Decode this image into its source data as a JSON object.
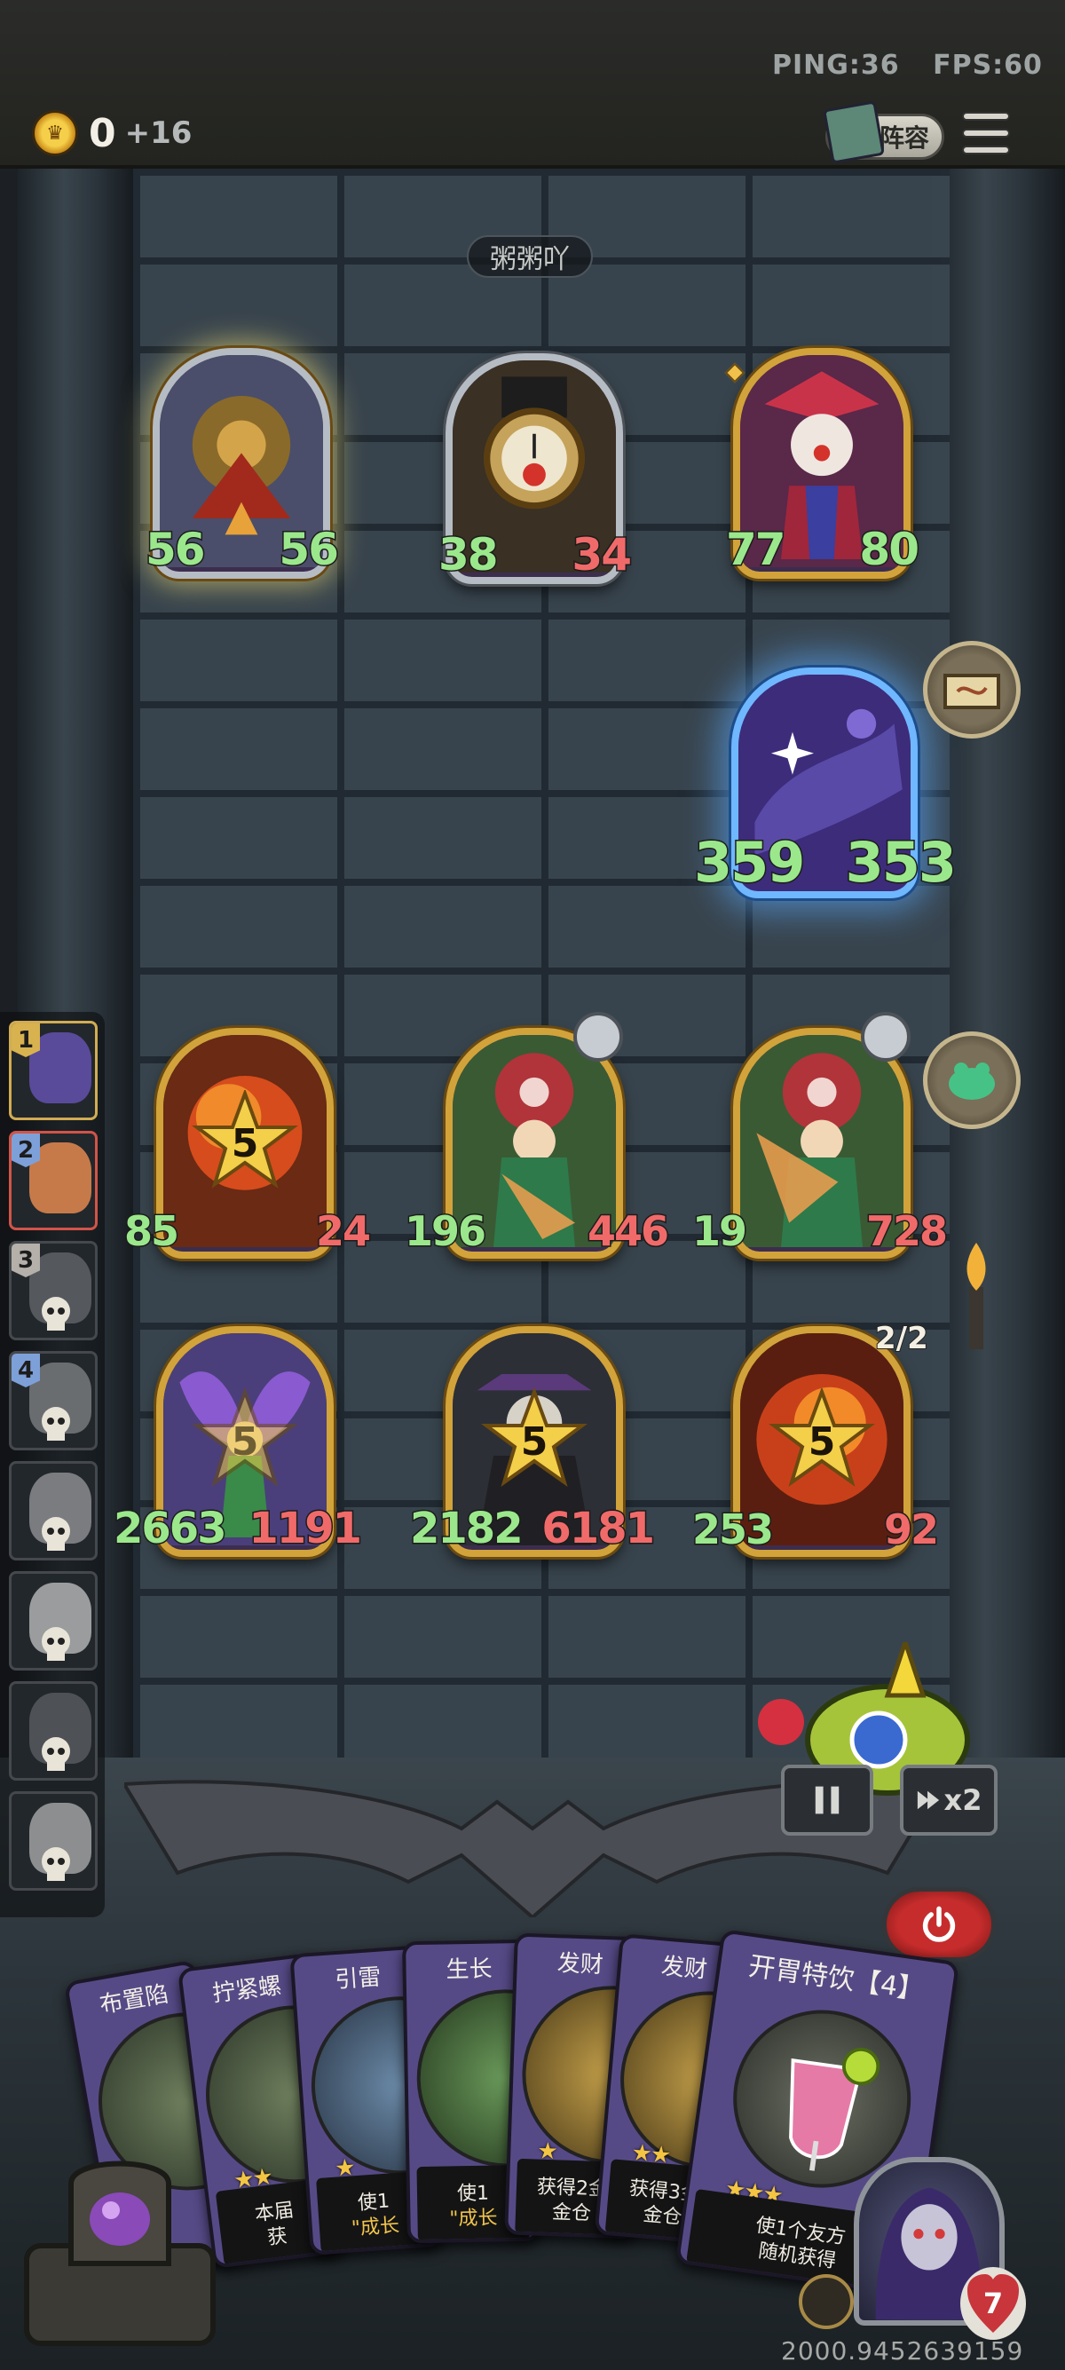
{
  "hud": {
    "ping": "PING:36",
    "fps": "FPS:60",
    "gold": "0",
    "gold_income": "+16",
    "lineup_label": "阵容"
  },
  "opponent": {
    "name": "粥粥吖"
  },
  "enemy_board": [
    {
      "attack": "56",
      "health": "56",
      "frame": "silver"
    },
    {
      "attack": "38",
      "health": "34",
      "frame": "silver"
    },
    {
      "attack": "77",
      "health": "80",
      "frame": "gold"
    }
  ],
  "enemy_boss": {
    "attack": "359",
    "health": "353"
  },
  "player_board": {
    "row1": [
      {
        "attack": "85",
        "health": "24",
        "star": "5"
      },
      {
        "attack": "196",
        "health": "446",
        "star": ""
      },
      {
        "attack": "19",
        "health": "728",
        "star": ""
      }
    ],
    "row2": [
      {
        "attack": "2663",
        "health": "1191",
        "star": "5"
      },
      {
        "attack": "2182",
        "health": "6181",
        "star": "5"
      },
      {
        "attack": "253",
        "health": "92",
        "star": "5",
        "counter": "2/2"
      }
    ]
  },
  "roster": [
    {
      "rank": "1"
    },
    {
      "rank": "2"
    },
    {
      "rank": "3"
    },
    {
      "rank": "4"
    }
  ],
  "controls": {
    "speed_label": "x2"
  },
  "hand": [
    {
      "name": "布置陷",
      "desc_line1": "",
      "desc_line2": ""
    },
    {
      "name": "拧紧螺",
      "desc_line1": "本届",
      "desc_line2": "获"
    },
    {
      "name": "引雷",
      "desc_line1": "使1",
      "desc_line2": "\"成长"
    },
    {
      "name": "生长",
      "desc_line1": "使1",
      "desc_line2": "\"成长"
    },
    {
      "name": "发财",
      "desc_line1": "获得2金",
      "desc_line2": "金仓"
    },
    {
      "name": "发财",
      "desc_line1": "获得3金",
      "desc_line2": "金仓"
    },
    {
      "name": "开胃特饮【4】",
      "desc_line1": "使1个友方",
      "desc_line2": "随机获得"
    }
  ],
  "hero": {
    "lives": "7"
  },
  "seed": "2000.9452639159"
}
